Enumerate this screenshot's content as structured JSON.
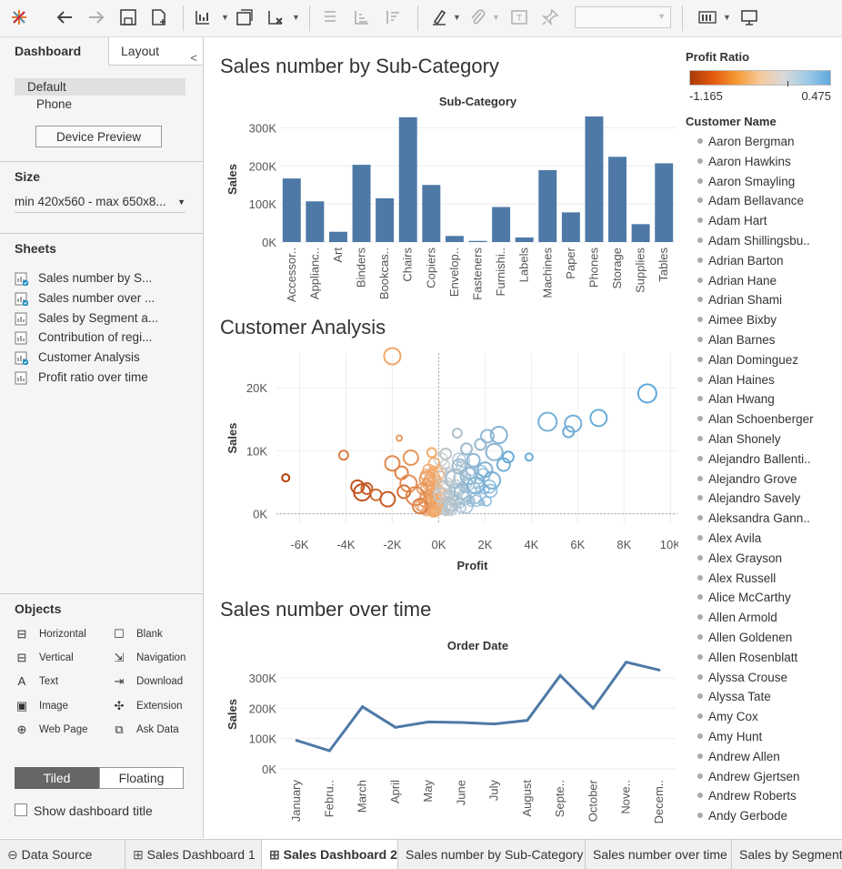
{
  "toolbar": {
    "icons": [
      "tableau-logo-icon",
      "undo-icon",
      "redo-icon",
      "save-icon",
      "new-data-source-icon",
      "new-worksheet-icon",
      "duplicate-icon",
      "clear-icon",
      "swap-icon",
      "sort-ascending-icon",
      "sort-descending-icon",
      "highlight-icon",
      "group-icon",
      "labels-icon",
      "fix-axes-icon",
      "fit-dropdown",
      "show-me-icon",
      "presentation-mode-icon"
    ]
  },
  "left_panel": {
    "tabs": {
      "dashboard": "Dashboard",
      "layout": "Layout"
    },
    "device": {
      "default": "Default",
      "phone": "Phone",
      "preview_button": "Device Preview"
    },
    "size": {
      "heading": "Size",
      "value": "min 420x560 - max 650x8..."
    },
    "sheets": {
      "heading": "Sheets",
      "items": [
        {
          "label": "Sales number by S...",
          "used": true
        },
        {
          "label": "Sales number over ...",
          "used": true
        },
        {
          "label": "Sales by Segment a...",
          "used": false
        },
        {
          "label": "Contribution of regi...",
          "used": false
        },
        {
          "label": "Customer Analysis",
          "used": true
        },
        {
          "label": "Profit ratio over time",
          "used": false
        }
      ]
    },
    "objects": {
      "heading": "Objects",
      "items": [
        {
          "label": "Horizontal",
          "icon": "horizontal-container-icon"
        },
        {
          "label": "Blank",
          "icon": "blank-icon"
        },
        {
          "label": "Vertical",
          "icon": "vertical-container-icon"
        },
        {
          "label": "Navigation",
          "icon": "navigation-icon"
        },
        {
          "label": "Text",
          "icon": "text-icon"
        },
        {
          "label": "Download",
          "icon": "download-icon"
        },
        {
          "label": "Image",
          "icon": "image-icon"
        },
        {
          "label": "Extension",
          "icon": "extension-icon"
        },
        {
          "label": "Web Page",
          "icon": "web-page-icon"
        },
        {
          "label": "Ask Data",
          "icon": "ask-data-icon"
        }
      ]
    },
    "layout_mode": {
      "tiled": "Tiled",
      "floating": "Floating"
    },
    "show_title": "Show dashboard title"
  },
  "colors": {
    "bar": "#4e79a7",
    "line": "#4e79a7",
    "accent": "#1f8dbf",
    "negative": "#c44e0b",
    "positive": "#5ea8dc"
  },
  "chart_data": [
    {
      "title": "Sales number by Sub-Category",
      "type": "bar",
      "xlabel": "Sub-Category",
      "ylabel": "Sales",
      "yticks": [
        "0K",
        "100K",
        "200K",
        "300K"
      ],
      "ylim": [
        0,
        330000
      ],
      "categories": [
        "Accessor..",
        "Applianc..",
        "Art",
        "Binders",
        "Bookcas..",
        "Chairs",
        "Copiers",
        "Envelop..",
        "Fasteners",
        "Furnishi..",
        "Labels",
        "Machines",
        "Paper",
        "Phones",
        "Storage",
        "Supplies",
        "Tables"
      ],
      "values": [
        167000,
        107000,
        27000,
        203000,
        115000,
        328000,
        150000,
        16000,
        3000,
        92000,
        12000,
        189000,
        78000,
        330000,
        224000,
        47000,
        207000
      ]
    },
    {
      "title": "Customer Analysis",
      "type": "scatter",
      "xlabel": "Profit",
      "ylabel": "Sales",
      "xticks": [
        "-6K",
        "-4K",
        "-2K",
        "0K",
        "2K",
        "4K",
        "6K",
        "8K",
        "10K"
      ],
      "yticks": [
        "0K",
        "10K",
        "20K"
      ],
      "xlim": [
        -7000,
        10300
      ],
      "ylim": [
        -1500,
        25500
      ],
      "points": [
        {
          "x": -6600,
          "y": 5700,
          "r": 4,
          "ratio": -1.0
        },
        {
          "x": -4100,
          "y": 9300,
          "r": 5,
          "ratio": -0.45
        },
        {
          "x": -3500,
          "y": 4300,
          "r": 7,
          "ratio": -0.8
        },
        {
          "x": -3300,
          "y": 3400,
          "r": 9,
          "ratio": -0.85
        },
        {
          "x": -3100,
          "y": 4000,
          "r": 6,
          "ratio": -0.7
        },
        {
          "x": -2700,
          "y": 3000,
          "r": 6,
          "ratio": -0.6
        },
        {
          "x": -2200,
          "y": 2300,
          "r": 8,
          "ratio": -0.75
        },
        {
          "x": -2000,
          "y": 25000,
          "r": 9,
          "ratio": -0.1
        },
        {
          "x": -1700,
          "y": 12000,
          "r": 3,
          "ratio": -0.2
        },
        {
          "x": -2000,
          "y": 8000,
          "r": 8,
          "ratio": -0.35
        },
        {
          "x": -1600,
          "y": 6500,
          "r": 7,
          "ratio": -0.4
        },
        {
          "x": -1300,
          "y": 4800,
          "r": 9,
          "ratio": -0.3
        },
        {
          "x": -1500,
          "y": 3500,
          "r": 7,
          "ratio": -0.55
        },
        {
          "x": -1000,
          "y": 2800,
          "r": 10,
          "ratio": -0.35
        },
        {
          "x": -800,
          "y": 1200,
          "r": 8,
          "ratio": -0.45
        },
        {
          "x": -1200,
          "y": 8900,
          "r": 8,
          "ratio": -0.25
        },
        {
          "x": -500,
          "y": 5500,
          "r": 8,
          "ratio": -0.15
        },
        {
          "x": -300,
          "y": 9700,
          "r": 5,
          "ratio": -0.05
        },
        {
          "x": -400,
          "y": 2000,
          "r": 6,
          "ratio": -0.2
        },
        {
          "x": -200,
          "y": 400,
          "r": 5,
          "ratio": -0.1
        },
        {
          "x": 100,
          "y": 3000,
          "r": 8,
          "ratio": 0.02
        },
        {
          "x": 300,
          "y": 9500,
          "r": 6,
          "ratio": 0.03
        },
        {
          "x": 500,
          "y": 1500,
          "r": 7,
          "ratio": 0.1
        },
        {
          "x": 700,
          "y": 5500,
          "r": 10,
          "ratio": 0.12
        },
        {
          "x": 800,
          "y": 12800,
          "r": 5,
          "ratio": 0.1
        },
        {
          "x": 900,
          "y": 7500,
          "r": 8,
          "ratio": 0.15
        },
        {
          "x": 1000,
          "y": 3500,
          "r": 8,
          "ratio": 0.2
        },
        {
          "x": 1200,
          "y": 10300,
          "r": 6,
          "ratio": 0.18
        },
        {
          "x": 1300,
          "y": 6000,
          "r": 9,
          "ratio": 0.22
        },
        {
          "x": 1500,
          "y": 8500,
          "r": 7,
          "ratio": 0.25
        },
        {
          "x": 1600,
          "y": 4500,
          "r": 9,
          "ratio": 0.3
        },
        {
          "x": 1800,
          "y": 11000,
          "r": 6,
          "ratio": 0.2
        },
        {
          "x": 2000,
          "y": 7000,
          "r": 8,
          "ratio": 0.3
        },
        {
          "x": 2100,
          "y": 12300,
          "r": 7,
          "ratio": 0.22
        },
        {
          "x": 2300,
          "y": 5300,
          "r": 9,
          "ratio": 0.32
        },
        {
          "x": 2400,
          "y": 9800,
          "r": 9,
          "ratio": 0.25
        },
        {
          "x": 2600,
          "y": 12500,
          "r": 9,
          "ratio": 0.28
        },
        {
          "x": 2800,
          "y": 7800,
          "r": 7,
          "ratio": 0.35
        },
        {
          "x": 3000,
          "y": 9000,
          "r": 6,
          "ratio": 0.4
        },
        {
          "x": 3900,
          "y": 9000,
          "r": 4,
          "ratio": 0.4
        },
        {
          "x": 4700,
          "y": 14600,
          "r": 10,
          "ratio": 0.35
        },
        {
          "x": 5600,
          "y": 13000,
          "r": 6,
          "ratio": 0.38
        },
        {
          "x": 5800,
          "y": 14300,
          "r": 9,
          "ratio": 0.36
        },
        {
          "x": 6900,
          "y": 15200,
          "r": 9,
          "ratio": 0.4
        },
        {
          "x": 9000,
          "y": 19100,
          "r": 10,
          "ratio": 0.45
        }
      ]
    },
    {
      "title": "Sales number over time",
      "type": "line",
      "xlabel": "Order Date",
      "ylabel": "Sales",
      "yticks": [
        "0K",
        "100K",
        "200K",
        "300K"
      ],
      "ylim": [
        0,
        360000
      ],
      "categories": [
        "January",
        "Febru..",
        "March",
        "April",
        "May",
        "June",
        "July",
        "August",
        "Septe..",
        "October",
        "Nove..",
        "Decem.."
      ],
      "values": [
        94000,
        60000,
        205000,
        137000,
        155000,
        153000,
        148000,
        160000,
        308000,
        200000,
        352000,
        326000
      ]
    }
  ],
  "legend": {
    "title": "Profit Ratio",
    "min_label": "-1.165",
    "max_label": "0.475",
    "customer_heading": "Customer Name",
    "customers": [
      "Aaron Bergman",
      "Aaron Hawkins",
      "Aaron Smayling",
      "Adam Bellavance",
      "Adam Hart",
      "Adam Shillingsbu..",
      "Adrian Barton",
      "Adrian Hane",
      "Adrian Shami",
      "Aimee Bixby",
      "Alan Barnes",
      "Alan Dominguez",
      "Alan Haines",
      "Alan Hwang",
      "Alan Schoenberger",
      "Alan Shonely",
      "Alejandro Ballenti..",
      "Alejandro Grove",
      "Alejandro Savely",
      "Aleksandra Gann..",
      "Alex Avila",
      "Alex Grayson",
      "Alex Russell",
      "Alice McCarthy",
      "Allen Armold",
      "Allen Goldenen",
      "Allen Rosenblatt",
      "Alyssa Crouse",
      "Alyssa Tate",
      "Amy Cox",
      "Amy Hunt",
      "Andrew Allen",
      "Andrew Gjertsen",
      "Andrew Roberts",
      "Andy Gerbode"
    ]
  },
  "bottom_tabs": [
    {
      "label": "Data Source",
      "icon": "data-source-icon",
      "active": false
    },
    {
      "label": "Sales Dashboard 1",
      "icon": "dashboard-icon",
      "active": false
    },
    {
      "label": "Sales Dashboard 2",
      "icon": "dashboard-icon",
      "active": true
    },
    {
      "label": "Sales number by Sub-Category",
      "icon": "",
      "active": false
    },
    {
      "label": "Sales number over time",
      "icon": "",
      "active": false
    },
    {
      "label": "Sales by Segment a",
      "icon": "",
      "active": false
    }
  ]
}
